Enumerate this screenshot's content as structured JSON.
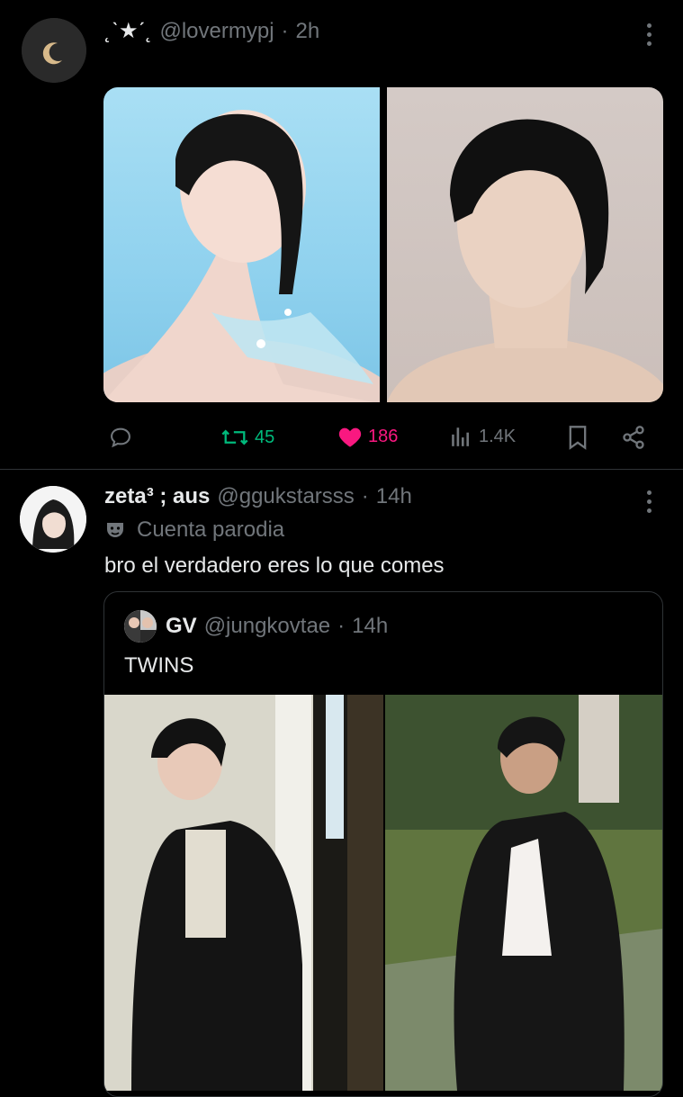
{
  "post1": {
    "display_name": "˛ˋ★ˊ˛",
    "handle": "@lovermypj",
    "separator": "·",
    "time": "2h",
    "avatar_icon": "crescent-moon-icon",
    "actions": {
      "reply_count": "",
      "retweet_count": "45",
      "like_count": "186",
      "views_count": "1.4K"
    },
    "colors": {
      "retweet": "#00ba7c",
      "like": "#f91880"
    }
  },
  "post2": {
    "display_name": "zeta³ ; aus",
    "handle": "@ggukstarsss",
    "separator": "·",
    "time": "14h",
    "badge_label": "Cuenta parodia",
    "text": "bro el verdadero eres lo que comes",
    "quote": {
      "display_name": "GV",
      "handle": "@jungkovtae",
      "separator": "·",
      "time": "14h",
      "text": "TWINS"
    }
  }
}
